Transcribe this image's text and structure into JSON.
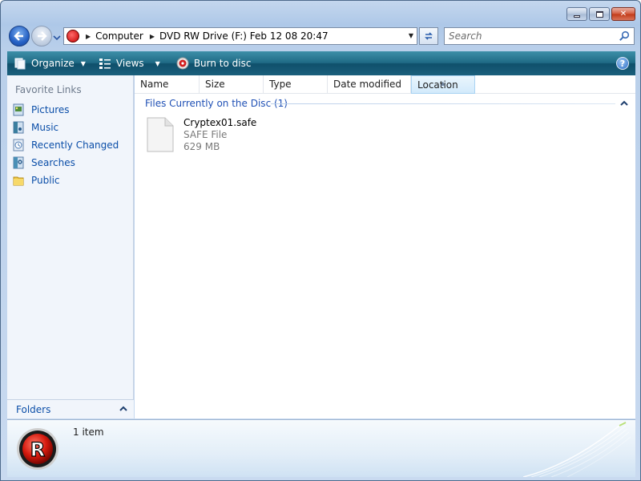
{
  "window": {
    "caption_buttons": [
      "minimize",
      "maximize",
      "close"
    ]
  },
  "navigation": {
    "address_segments": [
      "Computer",
      "DVD RW Drive (F:) Feb 12 08 20:47"
    ],
    "search_placeholder": "Search"
  },
  "toolbar": {
    "organize_label": "Organize",
    "views_label": "Views",
    "burn_label": "Burn to disc",
    "help_label": "?"
  },
  "sidebar": {
    "title": "Favorite Links",
    "items": [
      {
        "label": "Pictures",
        "icon": "pictures-icon"
      },
      {
        "label": "Music",
        "icon": "music-icon"
      },
      {
        "label": "Recently Changed",
        "icon": "recently-changed-icon"
      },
      {
        "label": "Searches",
        "icon": "searches-icon"
      },
      {
        "label": "Public",
        "icon": "public-folder-icon"
      }
    ],
    "folders_label": "Folders"
  },
  "file_list": {
    "columns": [
      "Name",
      "Size",
      "Type",
      "Date modified",
      "Location"
    ],
    "active_column": "Location",
    "group_header": "Files Currently on the Disc (1)",
    "files": [
      {
        "name": "Cryptex01.safe",
        "type": "SAFE File",
        "size": "629 MB"
      }
    ]
  },
  "details": {
    "item_count": "1 item"
  },
  "colors": {
    "toolbar": "#1f6a85",
    "link": "#0b4ea8",
    "group_header": "#1f50b5"
  }
}
